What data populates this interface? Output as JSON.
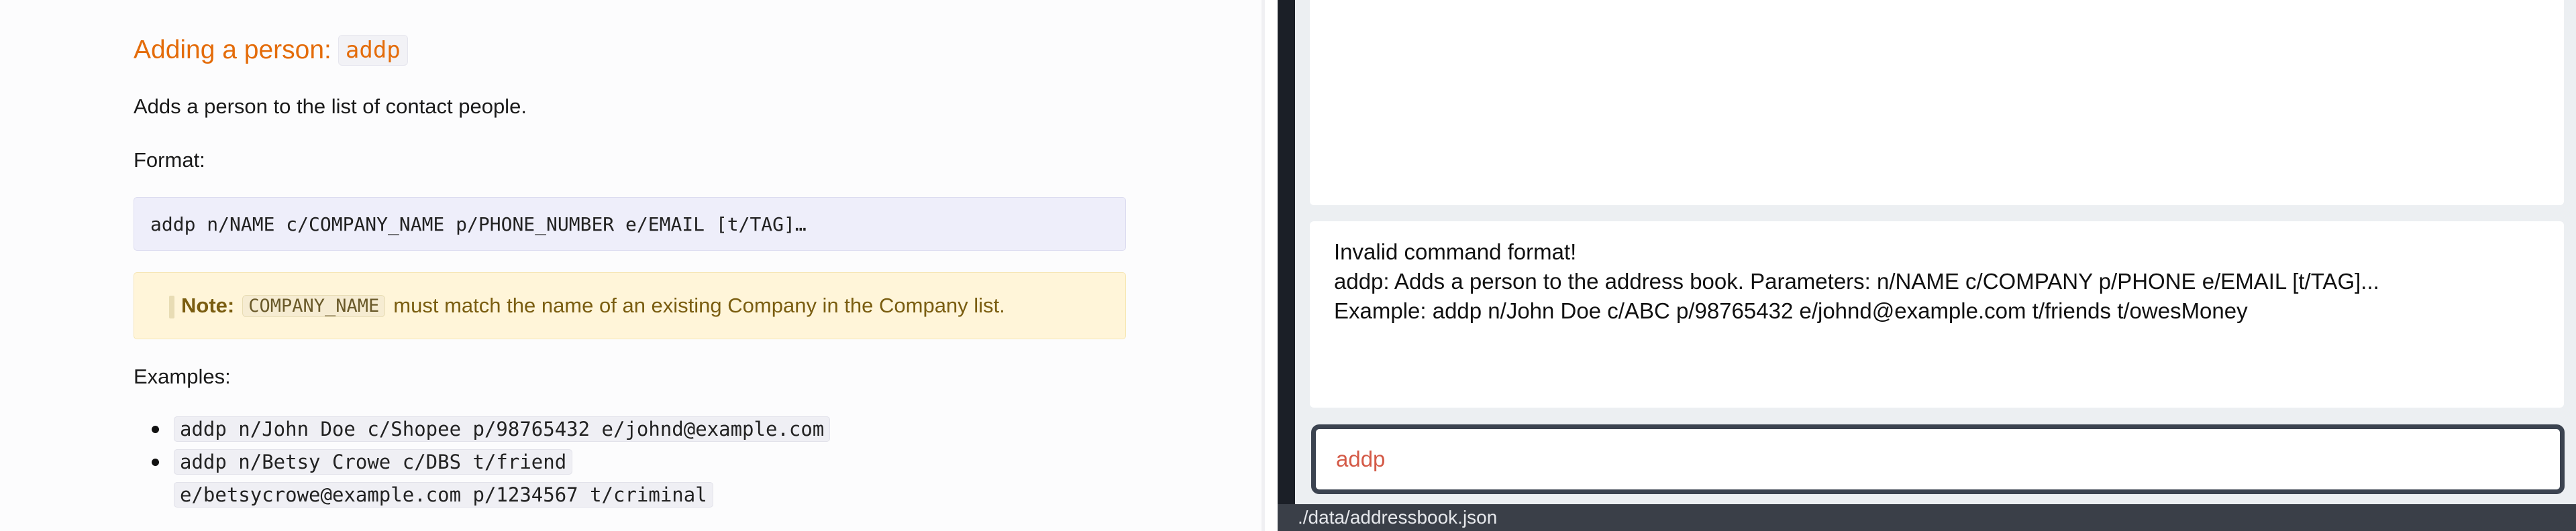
{
  "doc": {
    "heading_text": "Adding a person:",
    "heading_code": "addp",
    "description": "Adds a person to the list of contact people.",
    "format_label": "Format:",
    "format_code": "addp n/NAME c/COMPANY_NAME p/PHONE_NUMBER e/EMAIL [t/TAG]…",
    "note": {
      "label": "Note:",
      "code": "COMPANY_NAME",
      "text": "must match the name of an existing Company in the Company list."
    },
    "examples_label": "Examples:",
    "examples": [
      "addp n/John Doe c/Shopee p/98765432 e/johnd@example.com",
      "addp n/Betsy Crowe c/DBS t/friend e/betsycrowe@example.com p/1234567 t/criminal"
    ]
  },
  "app": {
    "result_lines": [
      "Invalid command format!",
      "addp: Adds a person to the address book. Parameters: n/NAME c/COMPANY p/PHONE e/EMAIL [t/TAG]...",
      "Example: addp n/John Doe c/ABC p/98765432 e/johnd@example.com t/friends t/owesMoney"
    ],
    "command_value": "addp",
    "status_path": "./data/addressbook.json"
  }
}
